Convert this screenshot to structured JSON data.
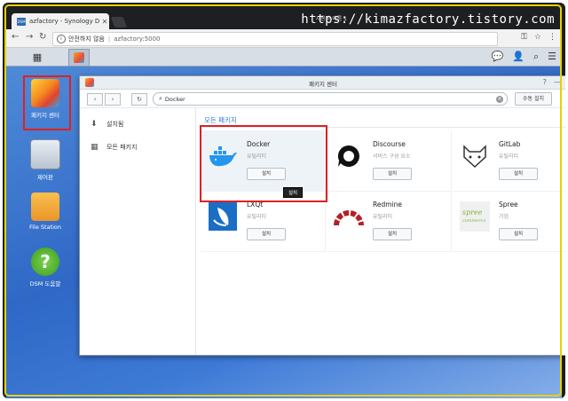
{
  "browser": {
    "tab_title": "azfactory - Synology Di",
    "watermark": "https://kimazfactory.tistory.com",
    "user_label": "사용자 이름 1",
    "security": "안전하지 않음",
    "url": "azfactory:5000"
  },
  "desktop": {
    "icons": [
      {
        "label": "패키지 센터"
      },
      {
        "label": "제어판"
      },
      {
        "label": "File Station"
      },
      {
        "label": "DSM 도움말"
      }
    ]
  },
  "window": {
    "title": "패키지 센터",
    "search_value": "Docker",
    "manual_install": "수동 설치",
    "sidebar": [
      {
        "label": "설치됨"
      },
      {
        "label": "모든 패키지"
      }
    ],
    "section": "모든 패키지",
    "packages": [
      {
        "name": "Docker",
        "sub": "유틸리티",
        "button": "설치"
      },
      {
        "name": "Discourse",
        "sub": "서비스 구성 요소",
        "button": "설치"
      },
      {
        "name": "GitLab",
        "sub": "유틸리티",
        "button": "설치"
      },
      {
        "name": "LXQt",
        "sub": "유틸리티",
        "button": "설치"
      },
      {
        "name": "Redmine",
        "sub": "유틸리티",
        "button": "설치"
      },
      {
        "name": "Spree",
        "sub": "기업",
        "button": "설치"
      }
    ],
    "tooltip": "설치"
  },
  "colors": {
    "highlight": "#e02020",
    "accent": "#2f7bc9",
    "frame": "#e9d100"
  }
}
